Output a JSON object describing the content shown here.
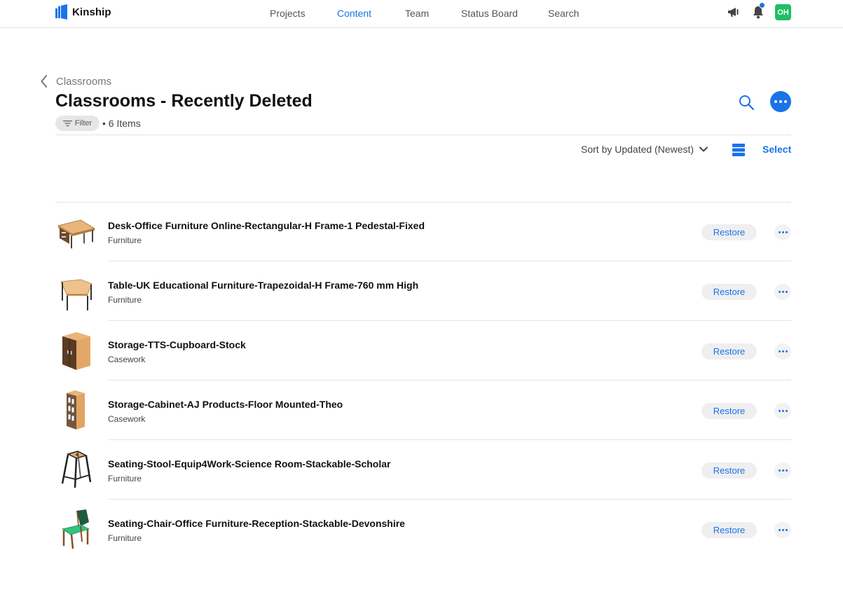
{
  "app": {
    "name": "Kinship"
  },
  "nav": {
    "items": [
      {
        "label": "Projects",
        "active": false
      },
      {
        "label": "Content",
        "active": true
      },
      {
        "label": "Team",
        "active": false
      },
      {
        "label": "Status Board",
        "active": false
      },
      {
        "label": "Search",
        "active": false
      }
    ]
  },
  "user": {
    "initials": "OH",
    "avatar_color": "#1fbf62"
  },
  "colors": {
    "accent": "#1a73e8"
  },
  "header": {
    "back_label": "Classrooms",
    "title": "Classrooms - Recently Deleted",
    "filter_label": "Filter",
    "item_count": "6 Items"
  },
  "toolbar": {
    "sort_label": "Sort by Updated (Newest)",
    "select_label": "Select"
  },
  "items": [
    {
      "name": "Desk-Office Furniture Online-Rectangular-H Frame-1 Pedestal-Fixed",
      "category": "Furniture",
      "thumb": "desk-icon",
      "restore_label": "Restore"
    },
    {
      "name": "Table-UK Educational Furniture-Trapezoidal-H Frame-760 mm High",
      "category": "Furniture",
      "thumb": "table-icon",
      "restore_label": "Restore"
    },
    {
      "name": "Storage-TTS-Cupboard-Stock",
      "category": "Casework",
      "thumb": "cupboard-icon",
      "restore_label": "Restore"
    },
    {
      "name": "Storage-Cabinet-AJ Products-Floor Mounted-Theo",
      "category": "Casework",
      "thumb": "cabinet-icon",
      "restore_label": "Restore"
    },
    {
      "name": "Seating-Stool-Equip4Work-Science Room-Stackable-Scholar",
      "category": "Furniture",
      "thumb": "stool-icon",
      "restore_label": "Restore"
    },
    {
      "name": "Seating-Chair-Office Furniture-Reception-Stackable-Devonshire",
      "category": "Furniture",
      "thumb": "chair-icon",
      "restore_label": "Restore"
    }
  ]
}
